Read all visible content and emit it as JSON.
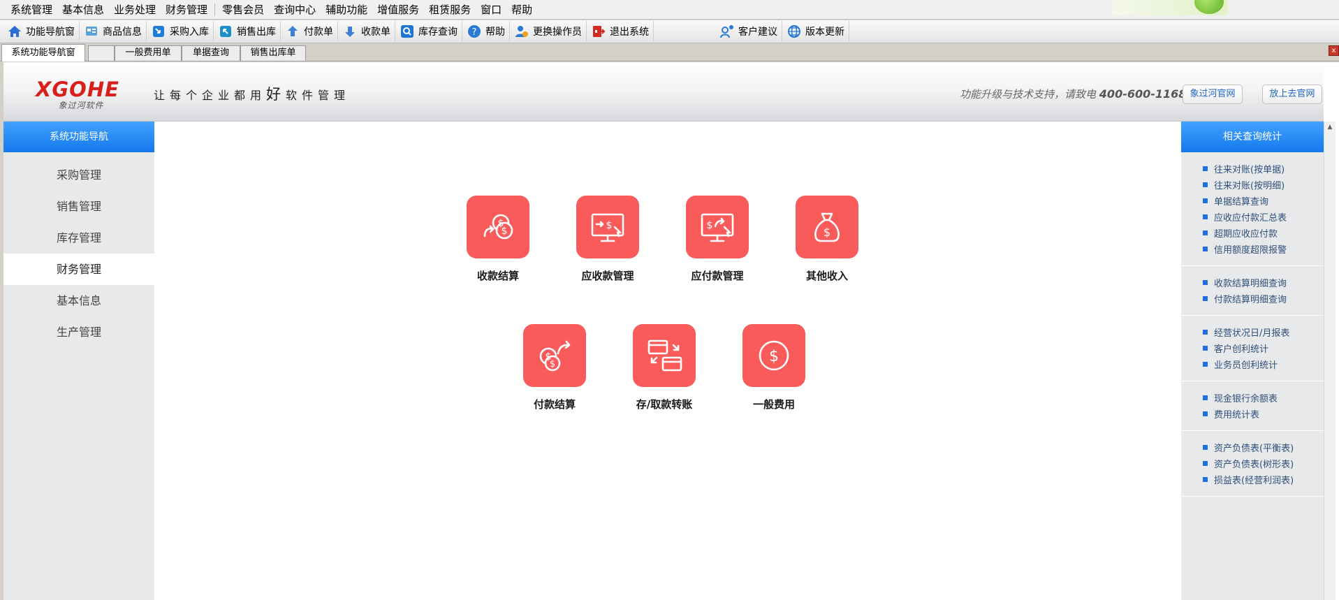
{
  "menu": {
    "items": [
      "系统管理",
      "基本信息",
      "业务处理",
      "财务管理",
      "零售会员",
      "查询中心",
      "辅助功能",
      "增值服务",
      "租赁服务",
      "窗口",
      "帮助"
    ]
  },
  "toolbar": {
    "buttons": [
      {
        "label": "功能导航窗",
        "icon": "home-icon"
      },
      {
        "label": "商品信息",
        "icon": "goods-icon"
      },
      {
        "label": "采购入库",
        "icon": "purchase-icon"
      },
      {
        "label": "销售出库",
        "icon": "sales-icon"
      },
      {
        "label": "付款单",
        "icon": "payment-icon"
      },
      {
        "label": "收款单",
        "icon": "receipt-icon"
      },
      {
        "label": "库存查询",
        "icon": "search-icon"
      },
      {
        "label": "帮助",
        "icon": "help-icon"
      },
      {
        "label": "更换操作员",
        "icon": "user-switch-icon"
      },
      {
        "label": "退出系统",
        "icon": "exit-icon"
      },
      {
        "label": "客户建议",
        "icon": "feedback-icon"
      },
      {
        "label": "版本更新",
        "icon": "globe-icon"
      }
    ]
  },
  "tabs": {
    "items": [
      "系统功能导航窗",
      "",
      "一般费用单",
      "单据查询",
      "销售出库单"
    ],
    "active_index": 0,
    "close_label": "x"
  },
  "banner": {
    "logo_main": "XGOHE",
    "logo_sub": "象过河软件",
    "slogan_pre": "让每个企业都用",
    "slogan_em": "好",
    "slogan_post": "软件管理",
    "support_text": "功能升级与技术支持，请致电",
    "support_phone": "400-600-1168",
    "btn_official": "象过河官网",
    "btn_fangshang": "放上去官网"
  },
  "leftnav": {
    "title": "系统功能导航",
    "items": [
      "采购管理",
      "销售管理",
      "库存管理",
      "财务管理",
      "基本信息",
      "生产管理"
    ],
    "active_index": 3
  },
  "main": {
    "tiles": [
      {
        "label": "收款结算",
        "icon": "coins-exchange-icon"
      },
      {
        "label": "应收款管理",
        "icon": "monitor-receivable-icon"
      },
      {
        "label": "应付款管理",
        "icon": "monitor-payable-icon"
      },
      {
        "label": "其他收入",
        "icon": "money-bag-icon"
      },
      {
        "label": "付款结算",
        "icon": "coins-send-icon"
      },
      {
        "label": "存/取款转账",
        "icon": "card-transfer-icon"
      },
      {
        "label": "一般费用",
        "icon": "dollar-circle-icon"
      }
    ],
    "tile_color": "#f95b5b"
  },
  "rightpanel": {
    "title": "相关查询统计",
    "groups": [
      [
        "往来对账(按单据)",
        "往来对账(按明细)",
        "单据结算查询",
        "应收应付款汇总表",
        "超期应收应付款",
        "信用额度超限报警"
      ],
      [
        "收款结算明细查询",
        "付款结算明细查询"
      ],
      [
        "经营状况日/月报表",
        "客户创利统计",
        "业务员创利统计"
      ],
      [
        "现金银行余额表",
        "费用统计表"
      ],
      [
        "资产负债表(平衡表)",
        "资产负债表(树形表)",
        "损益表(经营利润表)"
      ]
    ]
  },
  "colors": {
    "accent_blue": "#1678ec",
    "brand_red": "#d7201a",
    "tile_red": "#f95b5b"
  }
}
